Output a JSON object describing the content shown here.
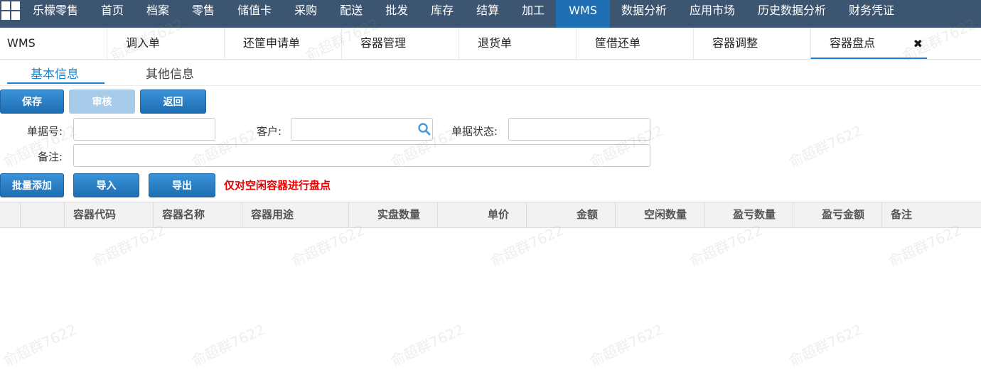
{
  "topnav": {
    "items": [
      "乐檬零售",
      "首页",
      "档案",
      "零售",
      "储值卡",
      "采购",
      "配送",
      "批发",
      "库存",
      "结算",
      "加工",
      "WMS",
      "数据分析",
      "应用市场",
      "历史数据分析",
      "财务凭证"
    ],
    "active": "WMS"
  },
  "tabs": {
    "items": [
      "WMS",
      "调入单",
      "还筐申请单",
      "容器管理",
      "退货单",
      "筐借还单",
      "容器调整",
      "容器盘点"
    ],
    "active": "容器盘点",
    "close_symbol": "✖"
  },
  "subtabs": {
    "basic": "基本信息",
    "other": "其他信息"
  },
  "toolbar": {
    "save": "保存",
    "audit": "审核",
    "back": "返回"
  },
  "form": {
    "doc_no_label": "单据号:",
    "doc_no_value": "",
    "customer_label": "客户:",
    "customer_value": "",
    "status_label": "单据状态:",
    "status_value": "",
    "remark_label": "备注:",
    "remark_value": ""
  },
  "actions": {
    "batch_add": "批量添加",
    "import": "导入",
    "export": "导出",
    "hint": "仅对空闲容器进行盘点"
  },
  "table": {
    "columns": [
      "",
      "",
      "容器代码",
      "容器名称",
      "容器用途",
      "实盘数量",
      "单价",
      "金额",
      "空闲数量",
      "盈亏数量",
      "盈亏金额",
      "备注"
    ],
    "rows": []
  },
  "watermark": "俞超群7622",
  "colors": {
    "nav_bg": "#3c5570",
    "nav_active": "#1e6fb3",
    "accent": "#1a86d0",
    "hint": "#e60000"
  }
}
